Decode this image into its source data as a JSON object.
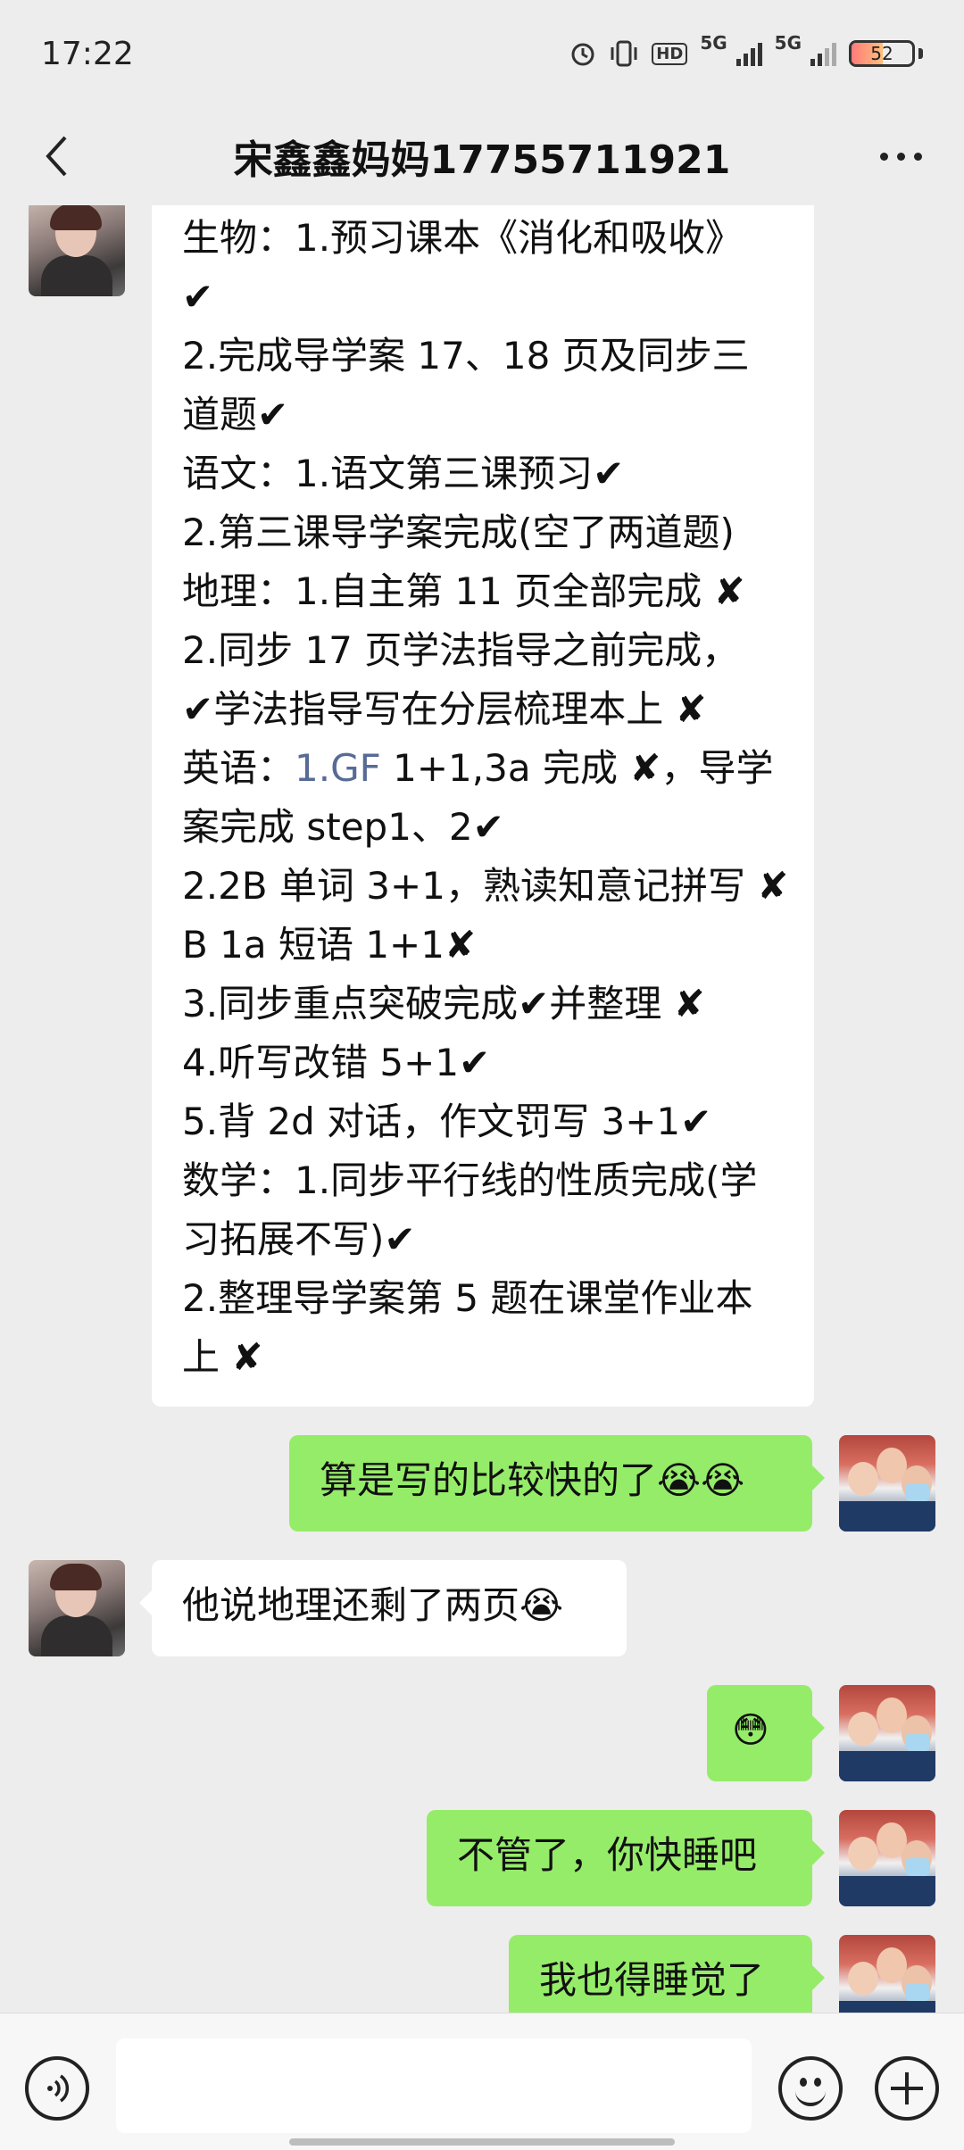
{
  "status_bar": {
    "time": "17:22",
    "hd_label": "HD",
    "network_1": "5G",
    "network_2": "5G",
    "battery_percent": "52",
    "battery_level": 0.52,
    "icons": [
      "alarm-icon",
      "vibrate-icon",
      "hd-icon",
      "signal-icon",
      "signal-icon",
      "battery-icon"
    ]
  },
  "header": {
    "title": "宋鑫鑫妈妈17755711921",
    "back_icon": "chevron-left-icon",
    "more_icon": "more-dots-icon"
  },
  "messages": [
    {
      "side": "left",
      "lines": [
        "生物：1.预习课本《消化和吸收》",
        "✔",
        "2.完成导学案 17、18 页及同步三",
        "道题✔",
        "语文：1.语文第三课预习✔",
        "2.第三课导学案完成(空了两道题)",
        "地理：1.自主第 11 页全部完成 ✘",
        "2.同步 17 页学法指导之前完成，",
        "✔学法指导写在分层梳理本上 ✘",
        "1.GF",
        " 1+1,3a 完成 ✘，导学",
        "案完成 step1、2✔",
        "2.2B 单词 3+1，熟读知意记拼写 ✘",
        "B 1a 短语 1+1✘",
        "3.同步重点突破完成✔并整理 ✘",
        "4.听写改错 5+1✔",
        "5.背 2d 对话，作文罚写 3+1✔",
        "数学：1.同步平行线的性质完成(学",
        "习拓展不写)✔",
        "2.整理导学案第 5 题在课堂作业本",
        "上 ✘"
      ],
      "english_prefix": "英语："
    },
    {
      "side": "right",
      "text": "算是写的比较快的了😭😭"
    },
    {
      "side": "left",
      "text": "他说地理还剩了两页😭"
    },
    {
      "side": "right",
      "text": "😳"
    },
    {
      "side": "right",
      "text": "不管了，你快睡吧"
    },
    {
      "side": "right",
      "text": "我也得睡觉了"
    }
  ],
  "input_bar": {
    "placeholder": "",
    "voice_icon": "voice-icon",
    "emoji_icon": "emoji-icon",
    "plus_icon": "plus-icon"
  },
  "colors": {
    "background": "#ededed",
    "bubble_self": "#95ec69",
    "bubble_other": "#ffffff",
    "link": "#576b95"
  }
}
